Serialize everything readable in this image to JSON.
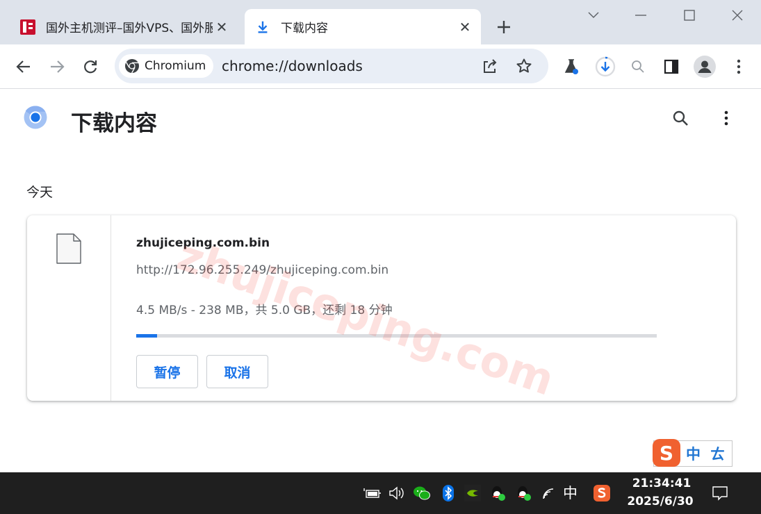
{
  "tabs": [
    {
      "title": "国外主机测评–国外VPS、国外服务器",
      "active": false
    },
    {
      "title": "下载内容",
      "active": true
    }
  ],
  "window_controls": [
    "minimize",
    "maximize",
    "close"
  ],
  "toolbar": {
    "chip_label": "Chromium",
    "url": "chrome://downloads",
    "icons": [
      "back-icon",
      "forward-icon",
      "reload-icon",
      "share-icon",
      "star-icon",
      "labs-icon",
      "download-icon",
      "zoom-icon",
      "side-panel-icon",
      "profile-icon",
      "menu-icon"
    ]
  },
  "page": {
    "title": "下载内容",
    "date_heading": "今天"
  },
  "download": {
    "file_name": "zhujiceping.com.bin",
    "url": "http://172.96.255.249/zhujiceping.com.bin",
    "status": "4.5 MB/s - 238 MB，共 5.0 GB，还剩 18 分钟",
    "progress_fraction": 0.04,
    "pause_label": "暂停",
    "cancel_label": "取消"
  },
  "watermark": "zhujiceping.com",
  "ime": {
    "logo": "S",
    "mode": "中",
    "punct": "ㄊ"
  },
  "taskbar": {
    "ime_indicator": "中",
    "time": "21:34:41",
    "date": "2025/6/30"
  },
  "colors": {
    "accent": "#1a73e8",
    "tabstrip": "#dee3eb",
    "omnibox": "#e9eef6",
    "taskbar": "#1f1f1f"
  }
}
